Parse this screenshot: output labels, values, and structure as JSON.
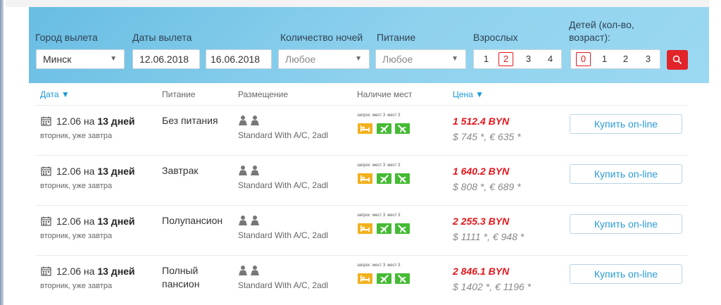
{
  "search": {
    "city_label": "Город вылета",
    "city_value": "Минск",
    "dates_label": "Даты вылета",
    "date_from": "12.06.2018",
    "date_to": "16.06.2018",
    "nights_label": "Количество ночей",
    "nights_value": "Любое",
    "meal_label": "Питание",
    "meal_value": "Любое",
    "adults_label": "Взрослых",
    "adults_options": [
      "1",
      "2",
      "3",
      "4"
    ],
    "adults_selected": "2",
    "children_label_line1": "Детей (кол-во,",
    "children_label_line2": "возраст):",
    "children_options": [
      "0",
      "1",
      "2",
      "3"
    ],
    "children_selected": "0",
    "search_icon": "search-icon",
    "accent_color": "#e2232a"
  },
  "table": {
    "headers": {
      "date": "Дата ▼",
      "meal": "Питание",
      "room": "Размещение",
      "availability": "Наличие мест",
      "price": "Цена ▼"
    },
    "rows": [
      {
        "date_prefix": "12.06 на ",
        "duration": "13 дней",
        "date_sub": "вторник, уже завтра",
        "meal_line1": "Без питания",
        "meal_line2": "",
        "room": "Standard With A/C, 2adl",
        "avail_labels": [
          "запрос",
          "мест 3",
          "мест 3"
        ],
        "price_main": "1 512.4 BYN",
        "price_alt": "$ 745 *, € 635 *",
        "buy_label": "Купить on-line"
      },
      {
        "date_prefix": "12.06 на ",
        "duration": "13 дней",
        "date_sub": "вторник, уже завтра",
        "meal_line1": "Завтрак",
        "meal_line2": "",
        "room": "Standard With A/C, 2adl",
        "avail_labels": [
          "запрос",
          "мест 3",
          "мест 3"
        ],
        "price_main": "1 640.2 BYN",
        "price_alt": "$ 808 *, € 689 *",
        "buy_label": "Купить on-line"
      },
      {
        "date_prefix": "12.06 на ",
        "duration": "13 дней",
        "date_sub": "вторник, уже завтра",
        "meal_line1": "Полупансион",
        "meal_line2": "",
        "room": "Standard With A/C, 2adl",
        "avail_labels": [
          "запрос",
          "мест 3",
          "мест 3"
        ],
        "price_main": "2 255.3 BYN",
        "price_alt": "$ 1111 *, € 948 *",
        "buy_label": "Купить on-line"
      },
      {
        "date_prefix": "12.06 на ",
        "duration": "13 дней",
        "date_sub": "вторник, уже завтра",
        "meal_line1": "Полный",
        "meal_line2": "пансион",
        "room": "Standard With A/C, 2adl",
        "avail_labels": [
          "запрос",
          "мест 3",
          "мест 3"
        ],
        "price_main": "2 846.1 BYN",
        "price_alt": "$ 1402 *, € 1196 *",
        "buy_label": "Купить on-line"
      }
    ]
  }
}
